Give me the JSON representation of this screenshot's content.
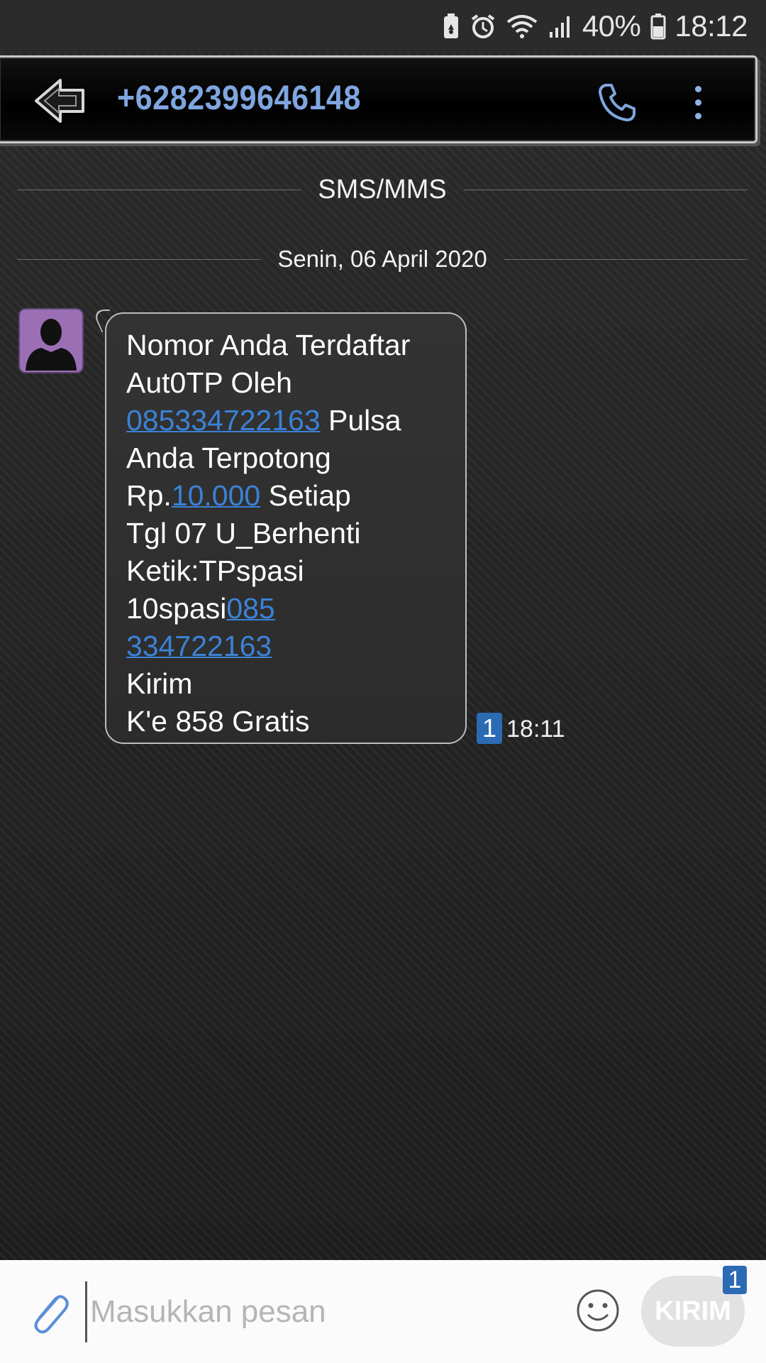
{
  "status_bar": {
    "battery_percent": "40%",
    "time": "18:12",
    "icons": [
      "battery-saver-icon",
      "alarm-icon",
      "wifi-icon",
      "signal-icon",
      "battery-icon"
    ]
  },
  "header": {
    "contact_number": "+6282399646148",
    "icons": [
      "back-arrow-icon",
      "phone-icon",
      "more-vert-icon"
    ]
  },
  "thread": {
    "type_label": "SMS/MMS",
    "date_label": "Senin, 06 April 2020"
  },
  "message": {
    "lines": [
      {
        "text": "Nomor Anda Terdaftar"
      },
      {
        "text": "Aut0TP Oleh"
      },
      {
        "link": "085334722163",
        "after": " Pulsa"
      },
      {
        "text": "Anda Terpotong"
      },
      {
        "before": "Rp.",
        "link": "10.000",
        "after": " Setiap"
      },
      {
        "text": "Tgl 07 U_Berhenti"
      },
      {
        "text": "Ketik:TPspasi"
      },
      {
        "before": "10spasi",
        "link": "085"
      },
      {
        "link": "334722163"
      },
      {
        "text": "Kirim"
      },
      {
        "text": "K'e 858 Gratis"
      }
    ],
    "sim_slot": "1",
    "time": "18:11"
  },
  "composer": {
    "placeholder": "Masukkan pesan",
    "send_label": "KIRIM",
    "sim_slot": "1",
    "icons": [
      "paperclip-icon",
      "emoji-icon"
    ]
  },
  "colors": {
    "link": "#3b82d6",
    "accent_blue": "#7fa6e0",
    "sim_badge": "#2c6bb4",
    "avatar_bg": "#9a6fb4"
  }
}
